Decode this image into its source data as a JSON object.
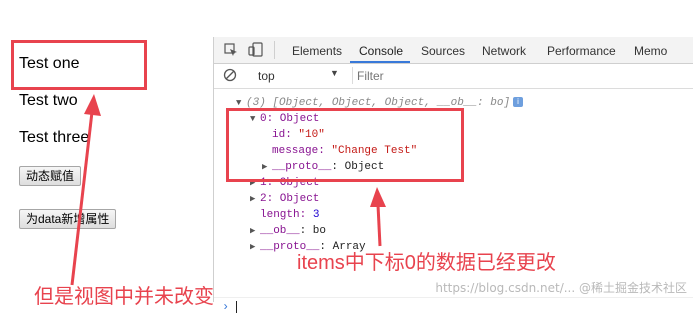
{
  "page": {
    "items": [
      "Test one",
      "Test two",
      "Test three"
    ],
    "buttons": [
      "动态赋值",
      "为data新增属性"
    ],
    "annotation_left": "但是视图中并未改变"
  },
  "devtools": {
    "tabs": [
      "Elements",
      "Console",
      "Sources",
      "Network",
      "Performance",
      "Memo"
    ],
    "active_tab": "Console",
    "context": "top",
    "filter_placeholder": "Filter",
    "console": {
      "array_summary": "(3) [Object, Object, Object, __ob__: bo]",
      "info_badge": "i",
      "item0_label": "0: Object",
      "item0_id_key": "id:",
      "item0_id_val": "\"10\"",
      "item0_msg_key": "message:",
      "item0_msg_val": "\"Change Test\"",
      "item0_proto_key": "__proto__",
      "item0_proto_val": ": Object",
      "item1": "1: Object",
      "item2": "2: Object",
      "length_key": "length:",
      "length_val": "3",
      "ob_key": "__ob__",
      "ob_val": ": bo",
      "proto_key": "__proto__",
      "proto_val": ": Array"
    },
    "annotation_right": "items中下标0的数据已经更改"
  },
  "watermark": "https://blog.csdn.net/...  @稀土掘金技术社区",
  "colors": {
    "annotation": "#e8434e",
    "accent": "#3879d9",
    "key": "#881391",
    "string": "#c41a16"
  }
}
